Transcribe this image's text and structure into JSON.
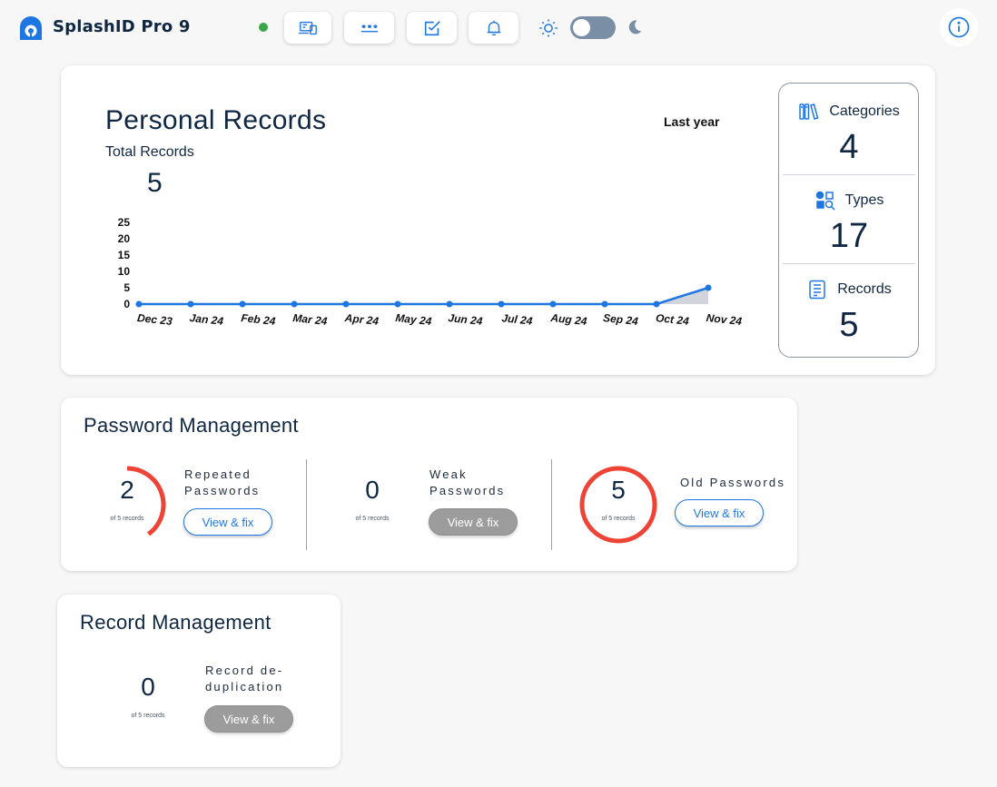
{
  "app": {
    "title": "SplashID Pro 9"
  },
  "header": {
    "tools": [
      {
        "icon": "devices-icon"
      },
      {
        "icon": "password-generator-icon"
      },
      {
        "icon": "checklist-icon"
      },
      {
        "icon": "bell-icon"
      }
    ],
    "theme_toggle": {
      "dark_mode": false
    },
    "status_color": "#3aa64a"
  },
  "personal_records": {
    "title": "Personal Records",
    "range": "Last year",
    "total_label": "Total Records",
    "total_value": "5",
    "stats": [
      {
        "icon": "books-icon",
        "label": "Categories",
        "value": "4"
      },
      {
        "icon": "shapes-search-icon",
        "label": "Types",
        "value": "17"
      },
      {
        "icon": "document-list-icon",
        "label": "Records",
        "value": "5"
      }
    ]
  },
  "chart_data": {
    "type": "line",
    "categories": [
      "Dec 23",
      "Jan 24",
      "Feb 24",
      "Mar 24",
      "Apr 24",
      "May 24",
      "Jun 24",
      "Jul 24",
      "Aug 24",
      "Sep 24",
      "Oct 24",
      "Nov 24"
    ],
    "values": [
      0,
      0,
      0,
      0,
      0,
      0,
      0,
      0,
      0,
      0,
      0,
      5
    ],
    "yticks": [
      "0",
      "5",
      "10",
      "15",
      "20",
      "25"
    ],
    "ylim": [
      0,
      25
    ],
    "grid": false,
    "line_color": "#1e76e3"
  },
  "password_management": {
    "title": "Password Management",
    "metrics": [
      {
        "value": "2",
        "of": "of 5 records",
        "label_lines": [
          "Repeated",
          "Passwords"
        ],
        "button": "View & fix",
        "fraction": 0.4,
        "enabled": true
      },
      {
        "value": "0",
        "of": "of 5 records",
        "label_lines": [
          "Weak",
          "Passwords"
        ],
        "button": "View & fix",
        "fraction": 0,
        "enabled": false
      },
      {
        "value": "5",
        "of": "of 5 records",
        "label_lines": [
          "Old Passwords"
        ],
        "button": "View & fix",
        "fraction": 1,
        "enabled": true
      }
    ]
  },
  "record_management": {
    "title": "Record Management",
    "metric": {
      "value": "0",
      "of": "of 5 records",
      "label_lines": [
        "Record de-",
        "duplication"
      ],
      "button": "View & fix",
      "fraction": 0,
      "enabled": false
    }
  },
  "colors": {
    "accent": "#1e76e3",
    "ring": "#ee4436",
    "text": "#0f2742"
  }
}
